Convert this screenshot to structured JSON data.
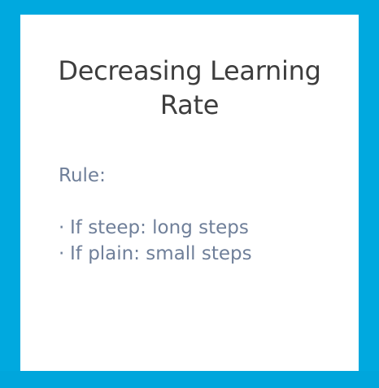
{
  "slide": {
    "title_line1": "Decreasing Learning",
    "title_line2": "Rate",
    "rule_label": "Rule:",
    "bullet_marker": "·",
    "bullets": [
      "If steep: long steps",
      "If plain: small steps"
    ]
  },
  "colors": {
    "background": "#00a9df",
    "card": "#ffffff",
    "title_text": "#3d3d3d",
    "body_text": "#6f7f99"
  }
}
